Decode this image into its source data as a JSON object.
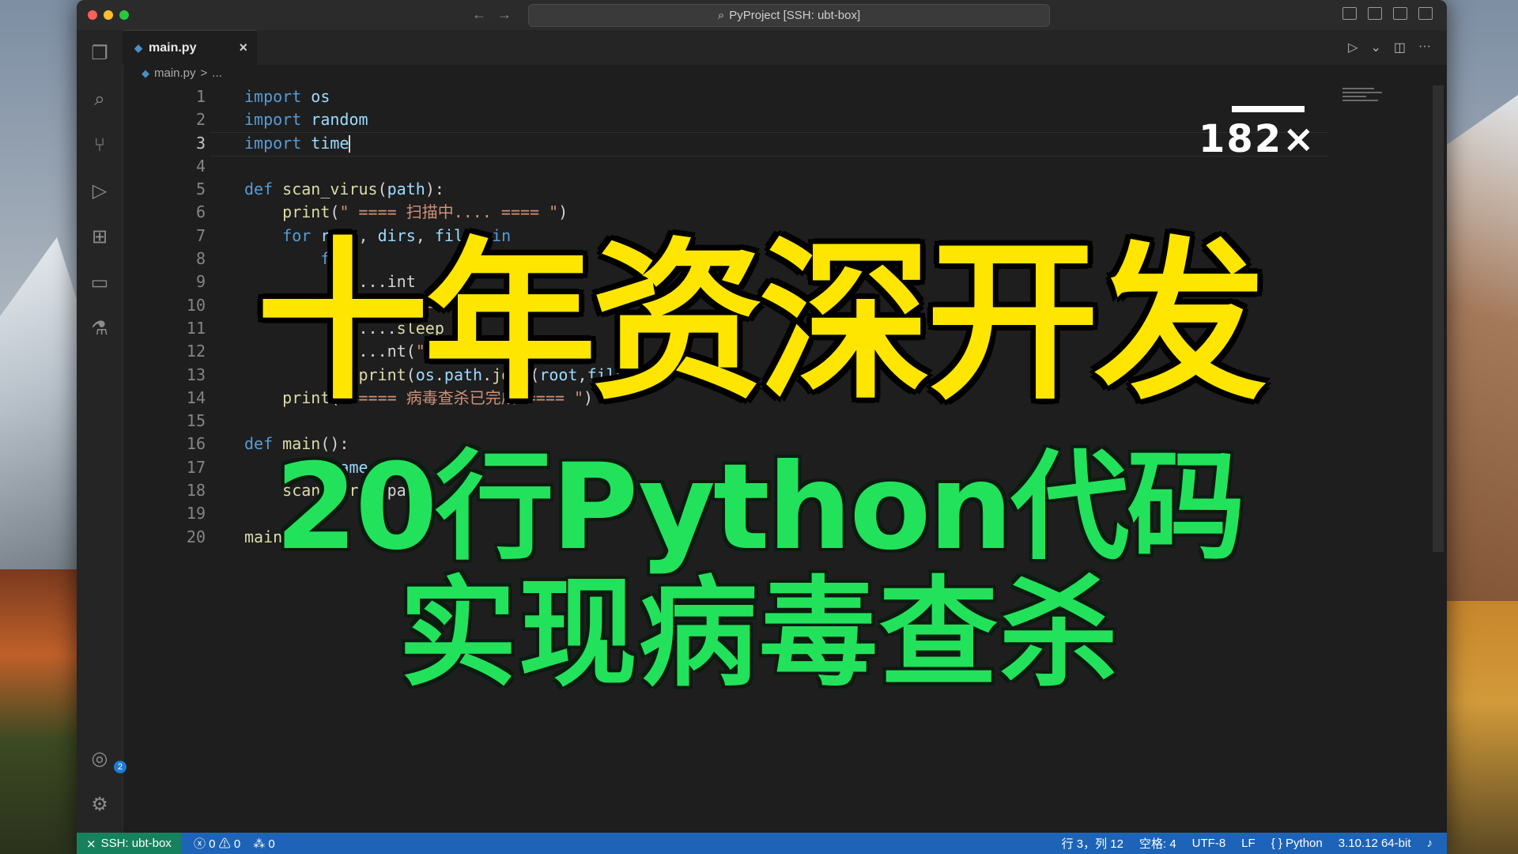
{
  "window": {
    "command_center": "PyProject [SSH: ubt-box]"
  },
  "tab": {
    "label": "main.py",
    "close": "×"
  },
  "breadcrumb": {
    "file": "main.py",
    "sep": ">",
    "more": "..."
  },
  "code_lines": [
    {
      "n": "1",
      "text": "import os"
    },
    {
      "n": "2",
      "text": "import random"
    },
    {
      "n": "3",
      "text": "import time"
    },
    {
      "n": "4",
      "text": ""
    },
    {
      "n": "5",
      "text": "def scan_virus(path):"
    },
    {
      "n": "6",
      "text": "    print(\" ==== 扫描中.... ==== \")"
    },
    {
      "n": "7",
      "text": "    for root, dirs, files in"
    },
    {
      "n": "8",
      "text": "        for"
    },
    {
      "n": "9",
      "text": "            ...int"
    },
    {
      "n": "10",
      "text": "            ...t(\" ==== \")"
    },
    {
      "n": "11",
      "text": "            ....sleep"
    },
    {
      "n": "12",
      "text": "            ...nt(\" ==== 病毒 ==== \")"
    },
    {
      "n": "13",
      "text": "            print(os.path.join(root,file))"
    },
    {
      "n": "14",
      "text": "    print(\" ==== 病毒查杀已完成 ==== \")"
    },
    {
      "n": "15",
      "text": ""
    },
    {
      "n": "16",
      "text": "def main():"
    },
    {
      "n": "17",
      "text": "    path_name = \"/"
    },
    {
      "n": "18",
      "text": "    scan_virus(pat"
    },
    {
      "n": "19",
      "text": ""
    },
    {
      "n": "20",
      "text": "main()"
    }
  ],
  "overlay": {
    "zoom": "182×",
    "headline": "十年资深开发",
    "sub1": "20行Python代码",
    "sub2": "实现病毒查杀"
  },
  "activity_badge": "2",
  "status": {
    "remote": "SSH: ubt-box",
    "errors": "0",
    "warnings": "0",
    "ports": "0",
    "position": "行 3，列 12",
    "spaces": "空格: 4",
    "encoding": "UTF-8",
    "eol": "LF",
    "language": "Python",
    "interpreter": "3.10.12 64-bit"
  },
  "colors": {
    "statusbar": "#1d64b8",
    "remote": "#16825d",
    "headline": "#ffe600",
    "subtitle": "#22e25c"
  }
}
